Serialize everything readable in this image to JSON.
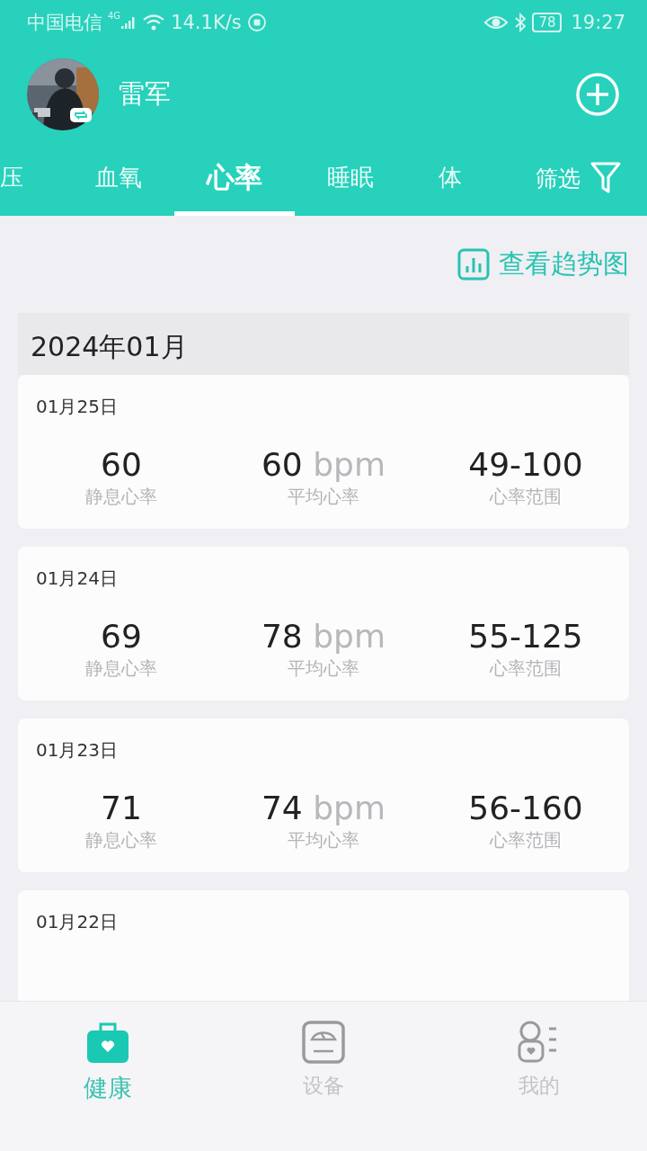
{
  "status_bar": {
    "carrier": "中国电信",
    "network": "4G",
    "speed": "14.1K/s",
    "battery": "78",
    "time": "19:27"
  },
  "header": {
    "user_name": "雷军"
  },
  "tabs": [
    {
      "label": "压",
      "selected": false
    },
    {
      "label": "血氧",
      "selected": false
    },
    {
      "label": "心率",
      "selected": true
    },
    {
      "label": "睡眠",
      "selected": false
    },
    {
      "label": "体",
      "selected": false
    }
  ],
  "filter": {
    "label": "筛选"
  },
  "trend_link": {
    "label": "查看趋势图"
  },
  "month": "2024年01月",
  "records": [
    {
      "date": "01月25日",
      "resting": "60",
      "resting_label": "静息心率",
      "average": "60",
      "unit": "bpm",
      "average_label": "平均心率",
      "range": "49-100",
      "range_label": "心率范围"
    },
    {
      "date": "01月24日",
      "resting": "69",
      "resting_label": "静息心率",
      "average": "78",
      "unit": "bpm",
      "average_label": "平均心率",
      "range": "55-125",
      "range_label": "心率范围"
    },
    {
      "date": "01月23日",
      "resting": "71",
      "resting_label": "静息心率",
      "average": "74",
      "unit": "bpm",
      "average_label": "平均心率",
      "range": "56-160",
      "range_label": "心率范围"
    },
    {
      "date": "01月22日"
    }
  ],
  "bottom_nav": [
    {
      "label": "健康",
      "kind": "health",
      "selected": true
    },
    {
      "label": "设备",
      "kind": "device",
      "selected": false
    },
    {
      "label": "我的",
      "kind": "profile",
      "selected": false
    }
  ]
}
